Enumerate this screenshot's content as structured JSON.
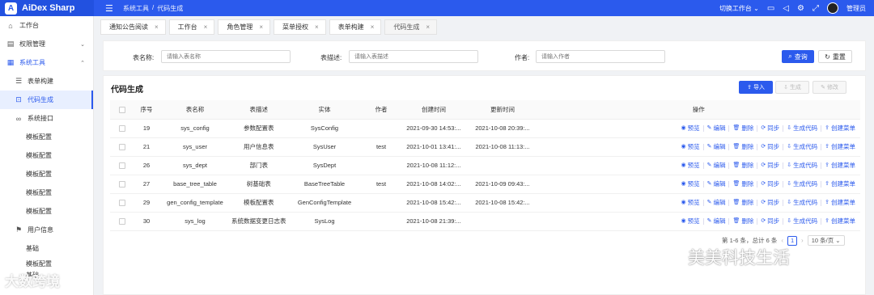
{
  "header": {
    "brand": "AiDex Sharp",
    "logo_letter": "A",
    "breadcrumb": [
      "系统工具",
      "/",
      "代码生成"
    ],
    "workspace_switch": "切换工作台",
    "user_name": "管理员"
  },
  "sidebar": {
    "items": [
      {
        "label": "工作台",
        "icon": "home-icon"
      },
      {
        "label": "权限管理",
        "icon": "shield-icon"
      },
      {
        "label": "系统工具",
        "icon": "grid-icon"
      },
      {
        "label": "表单构建",
        "icon": "list-icon"
      },
      {
        "label": "代码生成",
        "icon": "code-icon"
      },
      {
        "label": "系统接口",
        "icon": "link-icon"
      },
      {
        "label": "模板配置"
      },
      {
        "label": "模板配置"
      },
      {
        "label": "模板配置"
      },
      {
        "label": "模板配置"
      },
      {
        "label": "模板配置"
      },
      {
        "label": "用户信息",
        "icon": "flag-icon"
      },
      {
        "label": "基础"
      },
      {
        "label": "模板配置"
      },
      {
        "label": "基础"
      }
    ]
  },
  "tabs": [
    {
      "label": "通知公告阅读"
    },
    {
      "label": "工作台"
    },
    {
      "label": "角色管理"
    },
    {
      "label": "菜单授权"
    },
    {
      "label": "表单构建"
    },
    {
      "label": "代码生成"
    }
  ],
  "search": {
    "table_name_label": "表名称:",
    "table_name_placeholder": "请输入表名称",
    "table_desc_label": "表描述:",
    "table_desc_placeholder": "请输入表描述",
    "author_label": "作者:",
    "author_placeholder": "请输入作者",
    "query_button": "查询",
    "reset_button": "重置"
  },
  "panel": {
    "title": "代码生成",
    "import_button": "导入",
    "generate_button": "生成",
    "edit_button": "修改"
  },
  "table": {
    "columns": [
      "序号",
      "表名称",
      "表描述",
      "实体",
      "作者",
      "创建时间",
      "更新时间",
      "操作"
    ],
    "rows": [
      {
        "no": "19",
        "name": "sys_config",
        "desc": "参数配置表",
        "entity": "SysConfig",
        "author": "",
        "created": "2021-09-30 14:53:...",
        "updated": "2021-10-08 20:39:..."
      },
      {
        "no": "21",
        "name": "sys_user",
        "desc": "用户信息表",
        "entity": "SysUser",
        "author": "test",
        "created": "2021-10-01 13:41:...",
        "updated": "2021-10-08 11:13:..."
      },
      {
        "no": "26",
        "name": "sys_dept",
        "desc": "部门表",
        "entity": "SysDept",
        "author": "",
        "created": "2021-10-08 11:12:...",
        "updated": ""
      },
      {
        "no": "27",
        "name": "base_tree_table",
        "desc": "树基础表",
        "entity": "BaseTreeTable",
        "author": "test",
        "created": "2021-10-08 14:02:...",
        "updated": "2021-10-09 09:43:..."
      },
      {
        "no": "29",
        "name": "gen_config_template",
        "desc": "模板配置表",
        "entity": "GenConfigTemplate",
        "author": "",
        "created": "2021-10-08 15:42:...",
        "updated": "2021-10-08 15:42:..."
      },
      {
        "no": "30",
        "name": "sys_log",
        "desc": "系统数据变更日志表",
        "entity": "SysLog",
        "author": "",
        "created": "2021-10-08 21:39:...",
        "updated": ""
      }
    ],
    "actions": [
      "预览",
      "编辑",
      "删除",
      "同步",
      "生成代码",
      "创建菜单"
    ]
  },
  "pagination": {
    "summary": "第 1-6 条，总计 6 条",
    "current_page": "1",
    "page_size": "10 条/页"
  },
  "watermarks": {
    "left": "大数跨境",
    "right": "美美科技生活"
  }
}
